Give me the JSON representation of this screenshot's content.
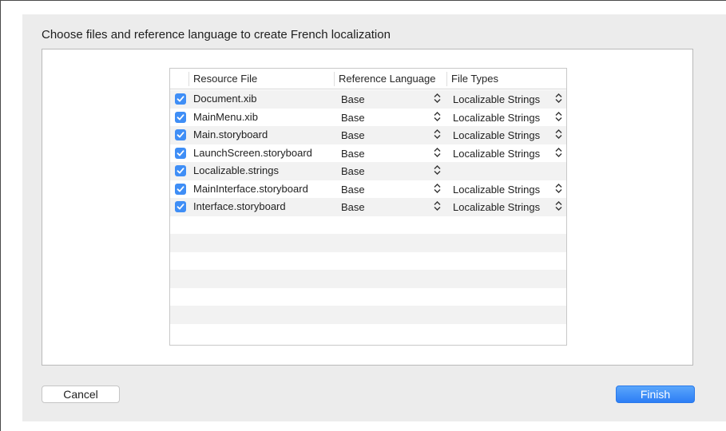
{
  "dialog": {
    "title": "Choose files and reference language to create French localization"
  },
  "table": {
    "columns": [
      "Resource File",
      "Reference Language",
      "File Types"
    ],
    "rows": [
      {
        "file": "Document.xib",
        "checked": true,
        "reference": "Base",
        "type": "Localizable Strings"
      },
      {
        "file": "MainMenu.xib",
        "checked": true,
        "reference": "Base",
        "type": "Localizable Strings"
      },
      {
        "file": "Main.storyboard",
        "checked": true,
        "reference": "Base",
        "type": "Localizable Strings"
      },
      {
        "file": "LaunchScreen.storyboard",
        "checked": true,
        "reference": "Base",
        "type": "Localizable Strings"
      },
      {
        "file": "Localizable.strings",
        "checked": true,
        "reference": "Base",
        "type": ""
      },
      {
        "file": "MainInterface.storyboard",
        "checked": true,
        "reference": "Base",
        "type": "Localizable Strings"
      },
      {
        "file": "Interface.storyboard",
        "checked": true,
        "reference": "Base",
        "type": "Localizable Strings"
      }
    ]
  },
  "buttons": {
    "cancel": "Cancel",
    "finish": "Finish"
  },
  "colors": {
    "accent": "#3f8ef6",
    "sheet_background": "#ececec"
  }
}
